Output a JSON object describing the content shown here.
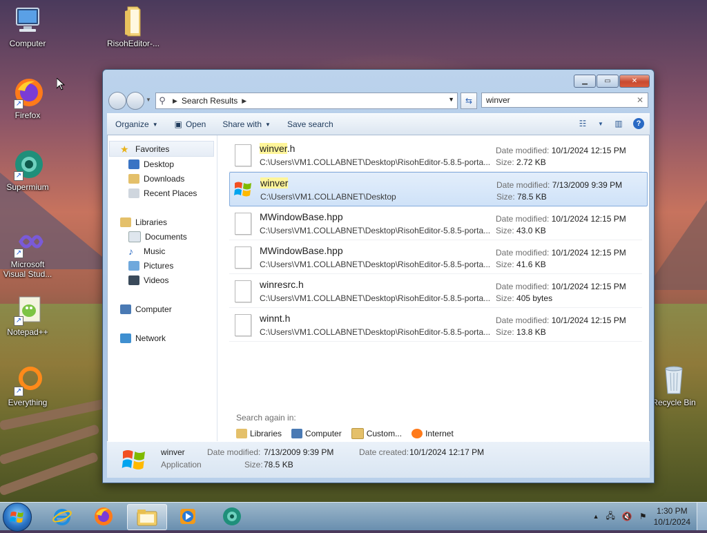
{
  "desktop": {
    "icons": [
      {
        "label": "Computer"
      },
      {
        "label": "RisohEditor-..."
      },
      {
        "label": "Firefox"
      },
      {
        "label": "Supermium"
      },
      {
        "label": "Microsoft Visual Stud..."
      },
      {
        "label": "Notepad++"
      },
      {
        "label": "Everything"
      },
      {
        "label": "Recycle Bin"
      }
    ]
  },
  "window": {
    "address": {
      "crumb": "Search Results"
    },
    "search": {
      "value": "winver"
    },
    "toolbar": {
      "organize": "Organize",
      "open": "Open",
      "share_with": "Share with",
      "save_search": "Save search"
    },
    "nav": {
      "favorites": "Favorites",
      "desktop": "Desktop",
      "downloads": "Downloads",
      "recent_places": "Recent Places",
      "libraries": "Libraries",
      "documents": "Documents",
      "music": "Music",
      "pictures": "Pictures",
      "videos": "Videos",
      "computer": "Computer",
      "network": "Network"
    },
    "results": [
      {
        "name_hl": "winver",
        "name_rest": ".h",
        "path": "C:\\Users\\VM1.COLLABNET\\Desktop\\RisohEditor-5.8.5-porta...",
        "date_label": "Date modified:",
        "date": "10/1/2024 12:15 PM",
        "size_label": "Size:",
        "size": "2.72 KB"
      },
      {
        "name_hl": "winver",
        "name_rest": "",
        "path": "C:\\Users\\VM1.COLLABNET\\Desktop",
        "date_label": "Date modified:",
        "date": "7/13/2009 9:39 PM",
        "size_label": "Size:",
        "size": "78.5 KB"
      },
      {
        "name_hl": "",
        "name_rest": "MWindowBase.hpp",
        "path": "C:\\Users\\VM1.COLLABNET\\Desktop\\RisohEditor-5.8.5-porta...",
        "date_label": "Date modified:",
        "date": "10/1/2024 12:15 PM",
        "size_label": "Size:",
        "size": "43.0 KB"
      },
      {
        "name_hl": "",
        "name_rest": "MWindowBase.hpp",
        "path": "C:\\Users\\VM1.COLLABNET\\Desktop\\RisohEditor-5.8.5-porta...",
        "date_label": "Date modified:",
        "date": "10/1/2024 12:15 PM",
        "size_label": "Size:",
        "size": "41.6 KB"
      },
      {
        "name_hl": "",
        "name_rest": "winresrc.h",
        "path": "C:\\Users\\VM1.COLLABNET\\Desktop\\RisohEditor-5.8.5-porta...",
        "date_label": "Date modified:",
        "date": "10/1/2024 12:15 PM",
        "size_label": "Size:",
        "size": "405 bytes"
      },
      {
        "name_hl": "",
        "name_rest": "winnt.h",
        "path": "C:\\Users\\VM1.COLLABNET\\Desktop\\RisohEditor-5.8.5-porta...",
        "date_label": "Date modified:",
        "date": "10/1/2024 12:15 PM",
        "size_label": "Size:",
        "size": "13.8 KB"
      }
    ],
    "search_again": {
      "label": "Search again in:",
      "links": [
        "Libraries",
        "Computer",
        "Custom...",
        "Internet"
      ]
    },
    "details": {
      "name": "winver",
      "type": "Application",
      "date_modified_label": "Date modified:",
      "date_modified": "7/13/2009 9:39 PM",
      "size_label": "Size:",
      "size": "78.5 KB",
      "date_created_label": "Date created:",
      "date_created": "10/1/2024 12:17 PM"
    }
  },
  "taskbar": {
    "time": "1:30 PM",
    "date": "10/1/2024"
  },
  "colors": {
    "highlight": "#fff59a",
    "selection": "#cfe2f8",
    "accent": "#2a6ac4"
  }
}
